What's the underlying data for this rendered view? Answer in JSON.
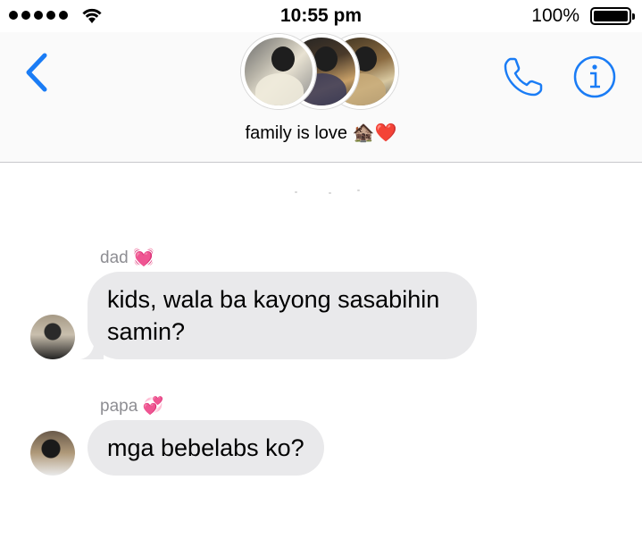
{
  "status_bar": {
    "time": "10:55 pm",
    "battery": "100%"
  },
  "header": {
    "group_name": "family is love 🏚️❤️",
    "avatar_count": 3
  },
  "messages": [
    {
      "sender": "dad 💓",
      "text_line1": "kids, wala ba kayong sasabihin",
      "text_line2": "samin?"
    },
    {
      "sender": "papa 💞",
      "text_line1": "mga bebelabs ko?"
    }
  ],
  "icons": [
    "back-chevron-icon",
    "phone-icon",
    "info-icon",
    "wifi-icon",
    "battery-icon",
    "signal-icon"
  ],
  "colors": {
    "accent": "#1a7cf5",
    "bubble": "#e9e9eb",
    "sender_label": "#8e8e93"
  }
}
